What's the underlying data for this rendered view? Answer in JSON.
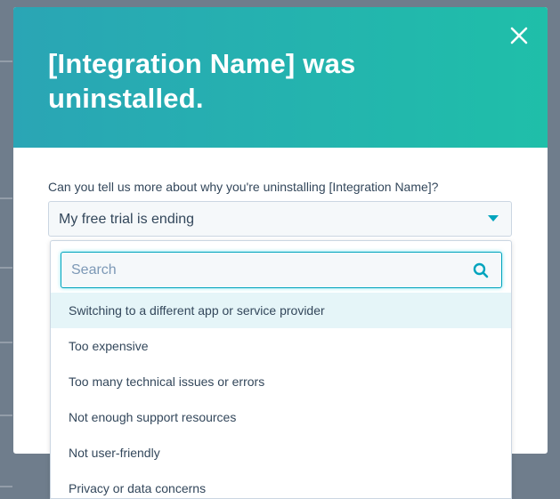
{
  "modal": {
    "title": "[Integration Name] was uninstalled.",
    "close_label": "close",
    "question": "Can you tell us more about why you're uninstalling [Integration Name]?",
    "selected_value": "My free trial is ending"
  },
  "dropdown": {
    "search_placeholder": "Search",
    "options": [
      {
        "label": "Switching to a different app or service provider",
        "highlighted": true
      },
      {
        "label": "Too expensive",
        "highlighted": false
      },
      {
        "label": "Too many technical issues or errors",
        "highlighted": false
      },
      {
        "label": "Not enough support resources",
        "highlighted": false
      },
      {
        "label": "Not user-friendly",
        "highlighted": false
      },
      {
        "label": "Privacy or data concerns",
        "highlighted": false
      }
    ]
  },
  "colors": {
    "header_gradient_start": "#2aa5b5",
    "header_gradient_end": "#1fbfa9",
    "text_primary": "#33475b",
    "focus_border": "#00a4bd",
    "highlight_row": "#e5f5f8",
    "caret": "#00a4bd"
  },
  "icons": {
    "close": "close-icon",
    "caret": "chevron-down-icon",
    "search": "search-icon"
  }
}
